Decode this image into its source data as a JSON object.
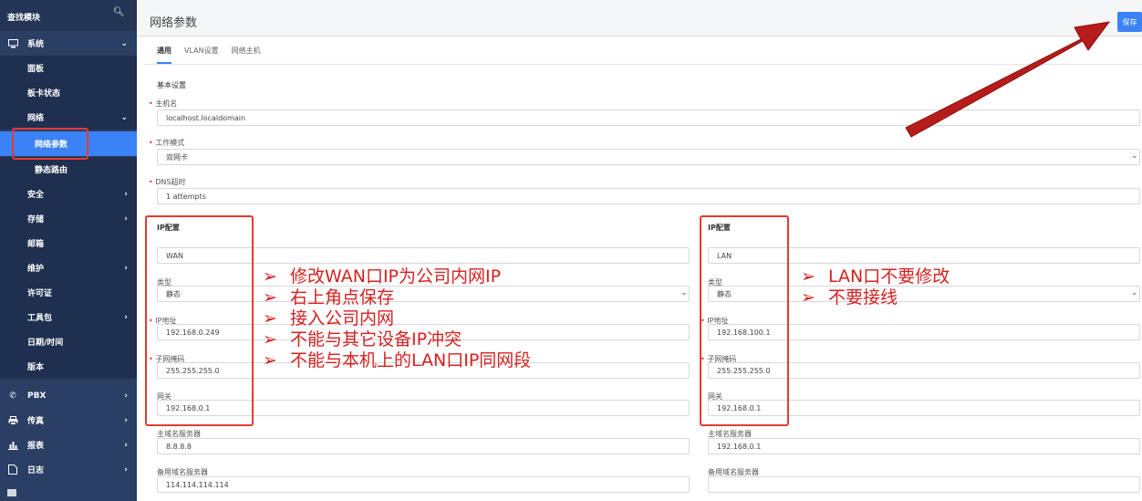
{
  "sidebar": {
    "search_label": "查找模块",
    "items": [
      {
        "label": "系统",
        "icon": "monitor-icon",
        "arrow": "⌄"
      },
      {
        "label": "面板"
      },
      {
        "label": "板卡状态"
      },
      {
        "label": "网络",
        "arrow": "⌄"
      },
      {
        "label": "网络参数"
      },
      {
        "label": "静态路由"
      },
      {
        "label": "安全",
        "arrow": "›"
      },
      {
        "label": "存储",
        "arrow": "›"
      },
      {
        "label": "邮箱"
      },
      {
        "label": "维护",
        "arrow": "›"
      },
      {
        "label": "许可证"
      },
      {
        "label": "工具包",
        "arrow": "›"
      },
      {
        "label": "日期/时间"
      },
      {
        "label": "版本"
      },
      {
        "label": "PBX",
        "icon": "phone-icon",
        "arrow": "›"
      },
      {
        "label": "传真",
        "icon": "printer-icon",
        "arrow": "›"
      },
      {
        "label": "报表",
        "icon": "bar-chart-icon",
        "arrow": "›"
      },
      {
        "label": "日志",
        "icon": "document-icon",
        "arrow": "›"
      }
    ]
  },
  "header": {
    "title": "网络参数",
    "save_label": "保存"
  },
  "tabs": [
    "通用",
    "VLAN设置",
    "网络主机"
  ],
  "basic": {
    "section": "基本设置",
    "hostname_label": "主机名",
    "hostname_value": "localhost.localdomain",
    "mode_label": "工作模式",
    "mode_value": "双网卡",
    "dns_label": "DNS超时",
    "dns_value": "1 attempts"
  },
  "wan": {
    "section": "IP配置",
    "name": "WAN",
    "type_label": "类型",
    "type_value": "静态",
    "ip_label": "IP地址",
    "ip_value": "192.168.0.249",
    "mask_label": "子网掩码",
    "mask_value": "255.255.255.0",
    "gateway_label": "网关",
    "gateway_value": "192.168.0.1",
    "dns1_label": "主域名服务器",
    "dns1_value": "8.8.8.8",
    "dns2_label": "备用域名服务器",
    "dns2_value": "114.114.114.114"
  },
  "lan": {
    "section": "IP配置",
    "name": "LAN",
    "type_label": "类型",
    "type_value": "静态",
    "ip_label": "IP地址",
    "ip_value": "192.168.100.1",
    "mask_label": "子网掩码",
    "mask_value": "255.255.255.0",
    "gateway_label": "网关",
    "gateway_value": "192.168.0.1",
    "dns1_label": "主域名服务器",
    "dns1_value": "192.168.0.1",
    "dns2_label": "备用域名服务器",
    "dns2_value": ""
  },
  "annotations": {
    "wan_notes": [
      "修改WAN口IP为公司内网IP",
      "右上角点保存",
      "接入公司内网",
      "不能与其它设备IP冲突",
      "不能与本机上的LAN口IP同网段"
    ],
    "lan_notes": [
      "LAN口不要修改",
      "不要接线"
    ],
    "bullet": "➢"
  },
  "colors": {
    "sidebar": "#2b3e63",
    "accent": "#3b82f6",
    "annotation": "#d62020",
    "arrow": "#b71c1c"
  }
}
